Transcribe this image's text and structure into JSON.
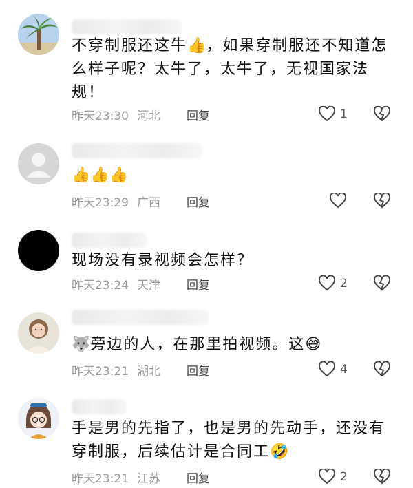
{
  "comments": [
    {
      "text_parts": [
        "不穿制服还这牛",
        "👍",
        "，如果穿制服还不知道怎么样子呢？太牛了，太牛了，无视国家法规！"
      ],
      "time": "昨天23:30",
      "location": "河北",
      "reply": "回复",
      "likes": "1",
      "avatar": "palm-tree-avatar"
    },
    {
      "text_parts": [
        "👍👍👍"
      ],
      "time": "昨天23:29",
      "location": "广西",
      "reply": "回复",
      "likes": "",
      "avatar": "default-gray-avatar"
    },
    {
      "text_parts": [
        "现场没有录视频会怎样？"
      ],
      "time": "昨天23:24",
      "location": "天津",
      "reply": "回复",
      "likes": "2",
      "avatar": "black-avatar"
    },
    {
      "text_parts": [
        "🐺",
        "旁边的人，在那里拍视频。这",
        "😅"
      ],
      "time": "昨天23:21",
      "location": "湖北",
      "reply": "回复",
      "likes": "4",
      "avatar": "girl-photo-avatar"
    },
    {
      "text_parts": [
        "手是男的先指了，也是男的先动手，还没有穿制服，后续估计是合同工",
        "🤣"
      ],
      "time": "昨天23:21",
      "location": "江苏",
      "reply": "回复",
      "likes": "2",
      "avatar": "cartoon-girl-avatar"
    }
  ],
  "icons": {
    "like": "heart-outline-icon",
    "dislike": "broken-heart-icon"
  },
  "colors": {
    "meta": "#9a9a9a",
    "text": "#111111",
    "reply": "#444444"
  }
}
